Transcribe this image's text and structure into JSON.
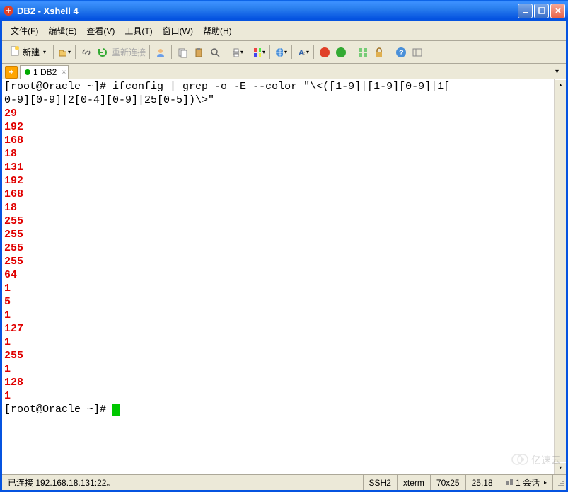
{
  "window": {
    "title": "DB2 - Xshell 4"
  },
  "menu": {
    "file": "文件(F)",
    "edit": "编辑(E)",
    "view": "查看(V)",
    "tools": "工具(T)",
    "window": "窗口(W)",
    "help": "帮助(H)"
  },
  "toolbar": {
    "new_label": "新建",
    "reconnect": "重新连接"
  },
  "tabs": {
    "tab1": "1 DB2"
  },
  "terminal": {
    "prompt": "[root@Oracle ~]# ",
    "cmd_line1": "ifconfig | grep -o -E --color \"\\<([1-9]|[1-9][0-9]|1[",
    "cmd_line2": "0-9][0-9]|2[0-4][0-9]|25[0-5])\\>\"",
    "output": [
      "29",
      "192",
      "168",
      "18",
      "131",
      "192",
      "168",
      "18",
      "255",
      "255",
      "255",
      "255",
      "64",
      "1",
      "5",
      "1",
      "127",
      "1",
      "255",
      "1",
      "128",
      "1"
    ],
    "prompt2": "[root@Oracle ~]# "
  },
  "status": {
    "conn": "已连接 192.168.18.131:22。",
    "proto": "SSH2",
    "term": "xterm",
    "size": "70x25",
    "cursor": "25,18",
    "sessions": "1 会话"
  },
  "watermark": "亿速云"
}
